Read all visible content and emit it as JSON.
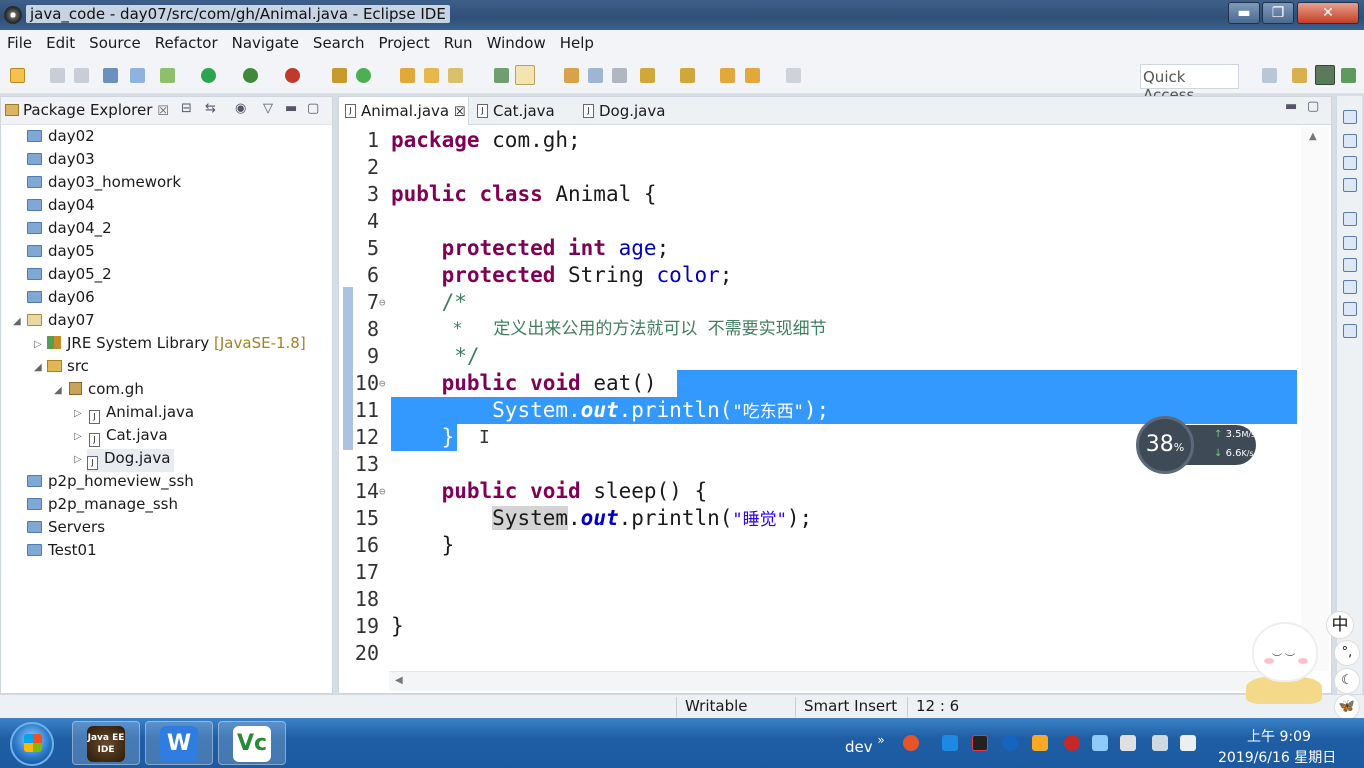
{
  "window": {
    "title": "java_code - day07/src/com/gh/Animal.java - Eclipse IDE",
    "min": "▬",
    "max": "❐",
    "close": "✕"
  },
  "menu": [
    "File",
    "Edit",
    "Source",
    "Refactor",
    "Navigate",
    "Search",
    "Project",
    "Run",
    "Window",
    "Help"
  ],
  "toolbar": {
    "quick_access": "Quick Access"
  },
  "package_explorer": {
    "tab_label": "Package Explorer",
    "items": [
      {
        "label": "day02"
      },
      {
        "label": "day03"
      },
      {
        "label": "day03_homework"
      },
      {
        "label": "day04"
      },
      {
        "label": "day04_2"
      },
      {
        "label": "day05"
      },
      {
        "label": "day05_2"
      },
      {
        "label": "day06"
      },
      {
        "label": "day07"
      },
      {
        "label": "JRE System Library",
        "decoration": "[JavaSE-1.8]"
      },
      {
        "label": "src"
      },
      {
        "label": "com.gh"
      },
      {
        "label": "Animal.java"
      },
      {
        "label": "Cat.java"
      },
      {
        "label": "Dog.java"
      },
      {
        "label": "p2p_homeview_ssh"
      },
      {
        "label": "p2p_manage_ssh"
      },
      {
        "label": "Servers"
      },
      {
        "label": "Test01"
      }
    ]
  },
  "editor": {
    "tabs": [
      "Animal.java",
      "Cat.java",
      "Dog.java"
    ],
    "line_numbers": [
      "1",
      "2",
      "3",
      "4",
      "5",
      "6",
      "7",
      "8",
      "9",
      "10",
      "11",
      "12",
      "13",
      "14",
      "15",
      "16",
      "17",
      "18",
      "19",
      "20"
    ],
    "code": {
      "l1_kw": "package",
      "l1_rest": " com.gh;",
      "l3_kw1": "public",
      "l3_kw2": "class",
      "l3_rest": " Animal {",
      "l5_kw1": "protected",
      "l5_kw2": "int",
      "l5_fld": "age",
      "l5_end": ";",
      "l6_kw1": "protected",
      "l6_type": " String ",
      "l6_fld": "color",
      "l6_end": ";",
      "l7": "/*",
      "l8": " *   定义出来公用的方法就可以 不需要实现细节",
      "l9": " */",
      "l10_kw1": "public",
      "l10_kw2": "void",
      "l10_rest": " eat() ",
      "l10_brace": "{",
      "l11_a": "System.",
      "l11_out": "out",
      "l11_b": ".println(",
      "l11_str": "\"吃东西\"",
      "l11_c": ");",
      "l12": "}",
      "l14_kw1": "public",
      "l14_kw2": "void",
      "l14_rest": " sleep() {",
      "l15_sys": "System",
      "l15_dot": ".",
      "l15_out": "out",
      "l15_b": ".println(",
      "l15_str": "\"睡觉\"",
      "l15_c": ");",
      "l16": "}",
      "l19": "}"
    }
  },
  "status": {
    "writable": "Writable",
    "insert_mode": "Smart Insert",
    "position": "12 : 6"
  },
  "net_widget": {
    "percent": "38",
    "percent_unit": "%",
    "up": "3.5",
    "up_unit": "M/s",
    "down": "6.6",
    "down_unit": "K/s"
  },
  "ime": {
    "lang": "中",
    "punct": "°,",
    "moon": "☾",
    "butterfly": "🦋"
  },
  "taskbar": {
    "tray_label": "dev",
    "chevron": "»",
    "time": "上午 9:09",
    "date": "2019/6/16 星期日",
    "eclipse_label": "Java EE IDE",
    "wps_label": "W",
    "vnc_label": "Vc"
  },
  "colors": {
    "keyword": "#7f0055",
    "field": "#0000c0",
    "comment": "#3f7f5f",
    "string": "#2a00ff",
    "selection": "#3399ff"
  }
}
